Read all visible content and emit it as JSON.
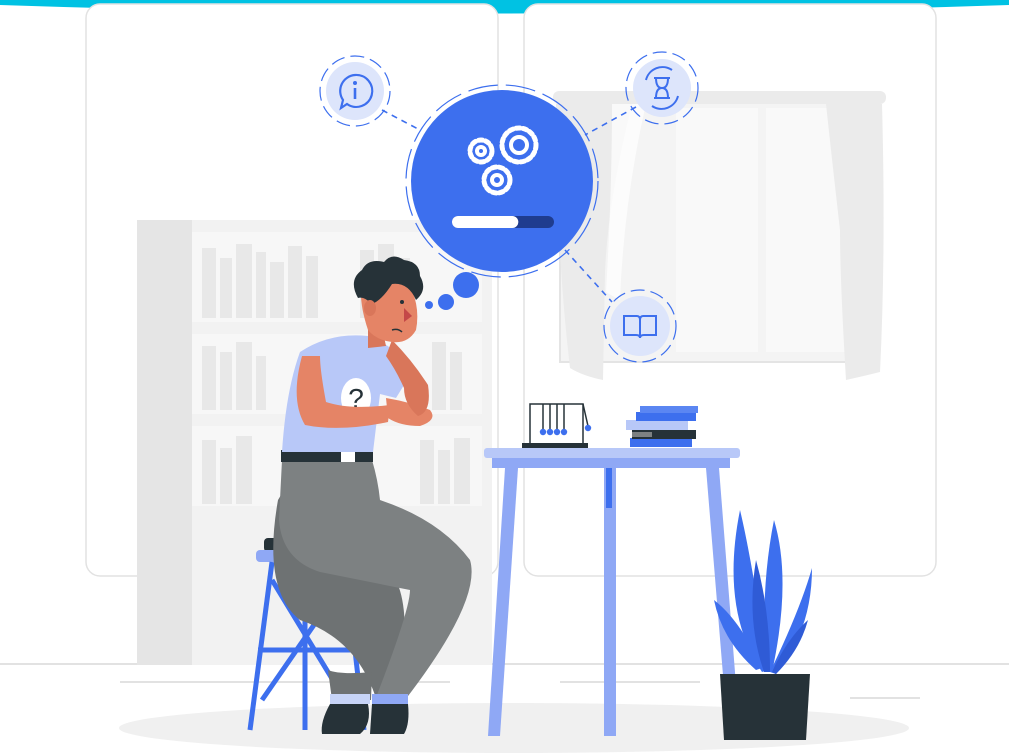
{
  "illustration": {
    "thought_icons": [
      "info-icon",
      "hourglass-icon",
      "book-icon"
    ],
    "main_bubble_icon": "gears-icon",
    "loading_progress": 0.65,
    "shirt_glyph": "?",
    "colors": {
      "accent_blue": "#3d6fee",
      "light_blue": "#8fa8f5",
      "pale_blue": "#dde5fb",
      "cyan_top_band": "#00c2e3",
      "dark": "#263238",
      "pants_gray": "#7d8182",
      "skin": "#e58466",
      "hair": "#263238",
      "furniture_gray": "#ebebeb"
    }
  }
}
